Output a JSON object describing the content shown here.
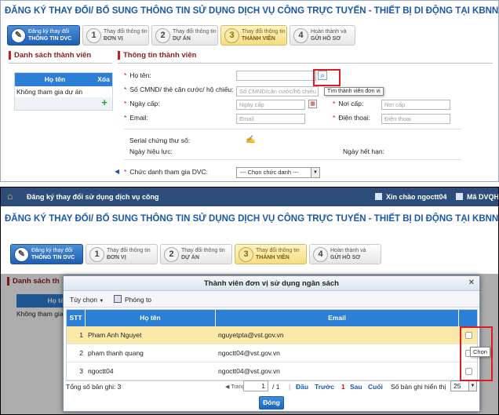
{
  "panel1": {
    "title": "ĐĂNG KÝ THAY ĐỔI/ BỔ SUNG THÔNG TIN SỬ DỤNG DỊCH VỤ CÔNG TRỰC TUYẾN - THIẾT BỊ DI ĐỘNG TẠI KBNN",
    "steps": [
      {
        "num": "",
        "line1": "Đăng ký thay đổi",
        "line2": "THÔNG TIN DVC"
      },
      {
        "num": "1",
        "line1": "Thay đổi thông tin",
        "line2": "ĐƠN VỊ"
      },
      {
        "num": "2",
        "line1": "Thay đổi thông tin",
        "line2": "DỰ ÁN"
      },
      {
        "num": "3",
        "line1": "Thay đổi thông tin",
        "line2": "THÀNH VIÊN"
      },
      {
        "num": "4",
        "line1": "Hoàn thành và",
        "line2": "GỬI HỒ SƠ"
      }
    ],
    "left": {
      "heading": "Danh sách thành viên",
      "col_name": "Họ tên",
      "col_delete": "Xóa",
      "row": "Không tham gia dự án",
      "add_icon": "plus-icon"
    },
    "right": {
      "heading": "Thông tin thành viên",
      "ho_ten": "Họ tên:",
      "search_tooltip": "Tìm thành viên đơn vị",
      "cmnd": "Số CMND/ thẻ căn cước/ hộ chiếu:",
      "cmnd_placeholder": "Số CMND/căn cước/hộ chiếu",
      "ngay_cap": "Ngày cấp:",
      "ngay_cap_placeholder": "Ngày cấp",
      "noi_cap": "Nơi cấp:",
      "noi_cap_placeholder": "Nơi cấp",
      "email": "Email:",
      "email_placeholder": "Email",
      "dien_thoai": "Điện thoại:",
      "dien_thoai_placeholder": "Điện thoại",
      "serial": "Serial chứng thư số:",
      "ngay_hieu_luc": "Ngày hiệu lực:",
      "ngay_het_han": "Ngày hết hạn:",
      "chuc_danh": "Chức danh tham gia DVC:",
      "chuc_danh_value": "--- Chọn chức danh ---"
    }
  },
  "panel2": {
    "topbar_title": "Đăng ký thay đổi sử dụng dịch vụ công",
    "greeting": "Xin chào ngoctt04",
    "unit": "Mã DVQHNS",
    "title": "ĐĂNG KÝ THAY ĐỔI/ BỔ SUNG THÔNG TIN SỬ DỤNG DỊCH VỤ CÔNG TRỰC TUYẾN - THIẾT BỊ DI ĐỘNG TẠI KBNN",
    "bg_heading": "Danh sách th",
    "bg_col": "Họ tên",
    "bg_row": "Không tham gia dự",
    "modal": {
      "title": "Thành viên đơn vị sử dụng ngân sách",
      "options": "Tùy chọn",
      "print": "Phóng to",
      "col_stt": "STT",
      "col_name": "Họ tên",
      "col_email": "Email",
      "rows": [
        {
          "stt": "1",
          "name": "Pham Anh Nguyet",
          "email": "nguyetpta@vst.gov.vn"
        },
        {
          "stt": "2",
          "name": "pham thanh quang",
          "email": "ngoctt04@vst.gov.vn"
        },
        {
          "stt": "3",
          "name": "ngoctt04",
          "email": "ngoctt04@vst.gov.vn"
        }
      ],
      "tooltip": "Chọn",
      "total": "Tổng số bản ghi: 3",
      "page_label": "Trang",
      "page_value": "1",
      "page_of": "/ 1",
      "first": "Đầu",
      "prev": "Trước",
      "current": "1",
      "next": "Sau",
      "last": "Cuối",
      "per_page_label": "Số bản ghi hiển thị",
      "per_page_value": "25",
      "close": "Đóng"
    }
  },
  "colors": {
    "accent": "#2b7fd6",
    "title": "#1b57a8",
    "highlight": "#e01b24",
    "selected_row": "#fbe9a9"
  }
}
